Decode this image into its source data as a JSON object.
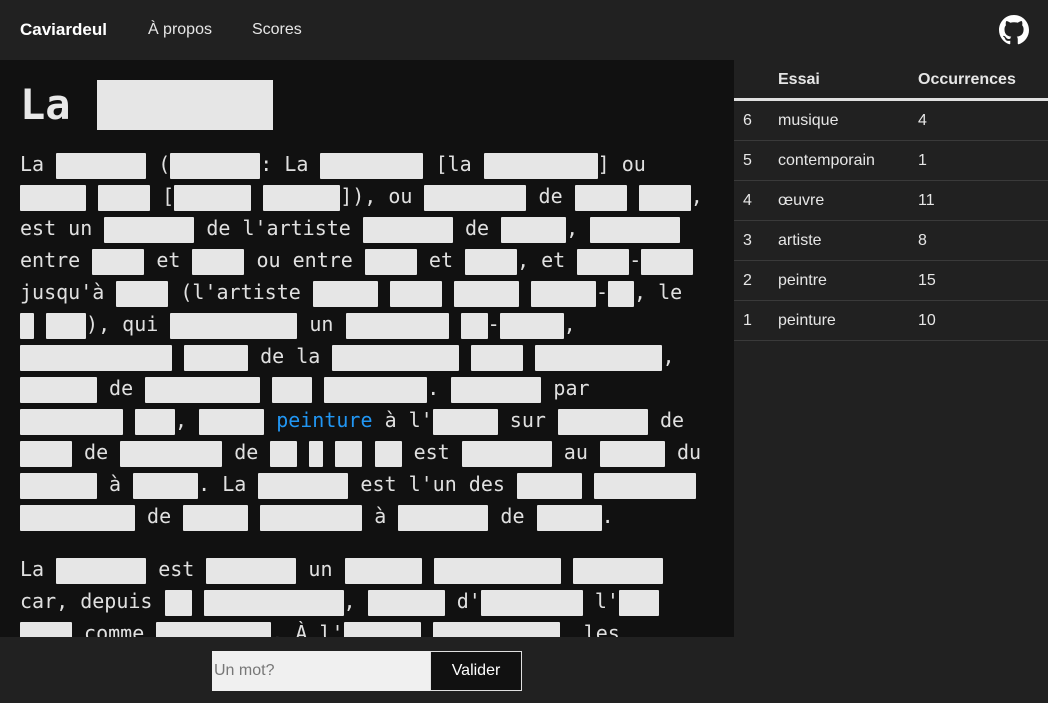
{
  "navbar": {
    "brand": "Caviardeul",
    "links": [
      "À propos",
      "Scores"
    ],
    "github_icon": "github-icon"
  },
  "article": {
    "title_word": "La",
    "found_word": "peinture",
    "tokens": {
      "t_la": "La",
      "t_open": "(",
      "t_colon_la": ": La",
      "t_bracket_la": "[la",
      "t_close_ou": "] ou",
      "t_bracket": "[",
      "t_close_ou2": "]), ou",
      "t_de": "de",
      "t_comma": ",",
      "t_est_un": "est un",
      "t_de_lartiste": "de l'artiste",
      "t_entre": "entre",
      "t_et": "et",
      "t_ou_entre": "ou entre",
      "t_comma_et": ", et",
      "t_dash": "-",
      "t_jusqua": "jusqu'à",
      "t_lartiste": "(l'artiste",
      "t_comma_le": ", le",
      "t_qui": "), qui",
      "t_un": "un",
      "t_de_la": "de la",
      "t_dot": ".",
      "t_par": "par",
      "t_a_l": "à l'",
      "t_sur": "sur",
      "t_est": "est",
      "t_au": "au",
      "t_du": "du",
      "t_a": "à",
      "t_dot_la": ". La",
      "t_est_lun_des": "est l'un des",
      "t_car_depuis": "car, depuis",
      "t_d": "d'",
      "t_l": "l'",
      "t_comme": "comme",
      "t_a_l2": ". À l'",
      "t_les": ", les"
    }
  },
  "table": {
    "headers": {
      "essai": "Essai",
      "occurrences": "Occurrences"
    },
    "rows": [
      {
        "num": "6",
        "word": "musique",
        "occ": "4"
      },
      {
        "num": "5",
        "word": "contemporain",
        "occ": "1"
      },
      {
        "num": "4",
        "word": "œuvre",
        "occ": "11"
      },
      {
        "num": "3",
        "word": "artiste",
        "occ": "8"
      },
      {
        "num": "2",
        "word": "peintre",
        "occ": "15"
      },
      {
        "num": "1",
        "word": "peinture",
        "occ": "10"
      }
    ]
  },
  "form": {
    "placeholder": "Un mot?",
    "value": "",
    "submit_label": "Valider"
  },
  "colors": {
    "background": "#212121",
    "article_background": "#111111",
    "mask": "#e6e6e6",
    "found_word": "#2196f3"
  }
}
